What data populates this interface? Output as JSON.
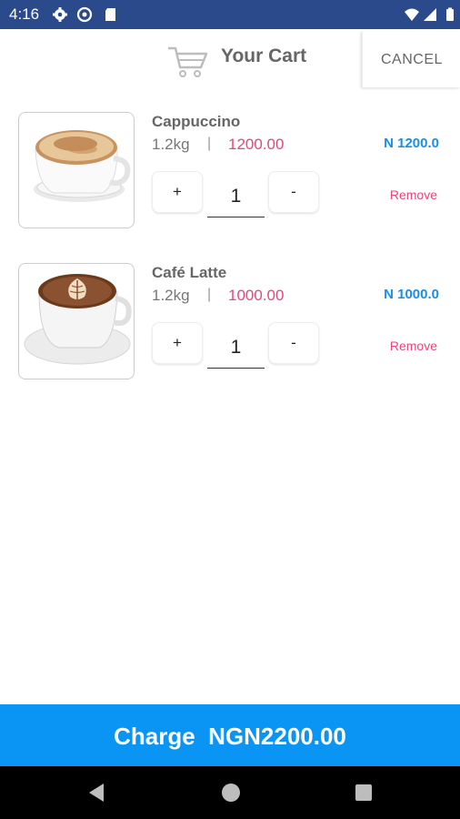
{
  "status_bar": {
    "time": "4:16",
    "icons": [
      "gear-icon",
      "data-saver-icon",
      "sd-card-icon",
      "wifi-icon",
      "signal-icon",
      "battery-icon"
    ]
  },
  "header": {
    "title": "Your Cart",
    "cancel_label": "CANCEL",
    "icon": "shopping-cart-icon"
  },
  "items": [
    {
      "name": "Cappuccino",
      "weight": "1.2kg",
      "separator": "|",
      "price": "1200.00",
      "total": "N 1200.0",
      "plus_label": "+",
      "quantity": "1",
      "minus_label": "-",
      "remove_label": "Remove"
    },
    {
      "name": "Café Latte",
      "weight": "1.2kg",
      "separator": "|",
      "price": "1000.00",
      "total": "N 1000.0",
      "plus_label": "+",
      "quantity": "1",
      "minus_label": "-",
      "remove_label": "Remove"
    }
  ],
  "charge": {
    "label": "Charge  NGN2200.00"
  },
  "colors": {
    "status_bar": "#2b4a8b",
    "accent_blue": "#0a95f5",
    "price_pink": "#e8467a",
    "total_blue": "#1a8ee8"
  },
  "nav": {
    "icons": [
      "back-icon",
      "home-icon",
      "recents-icon"
    ]
  }
}
